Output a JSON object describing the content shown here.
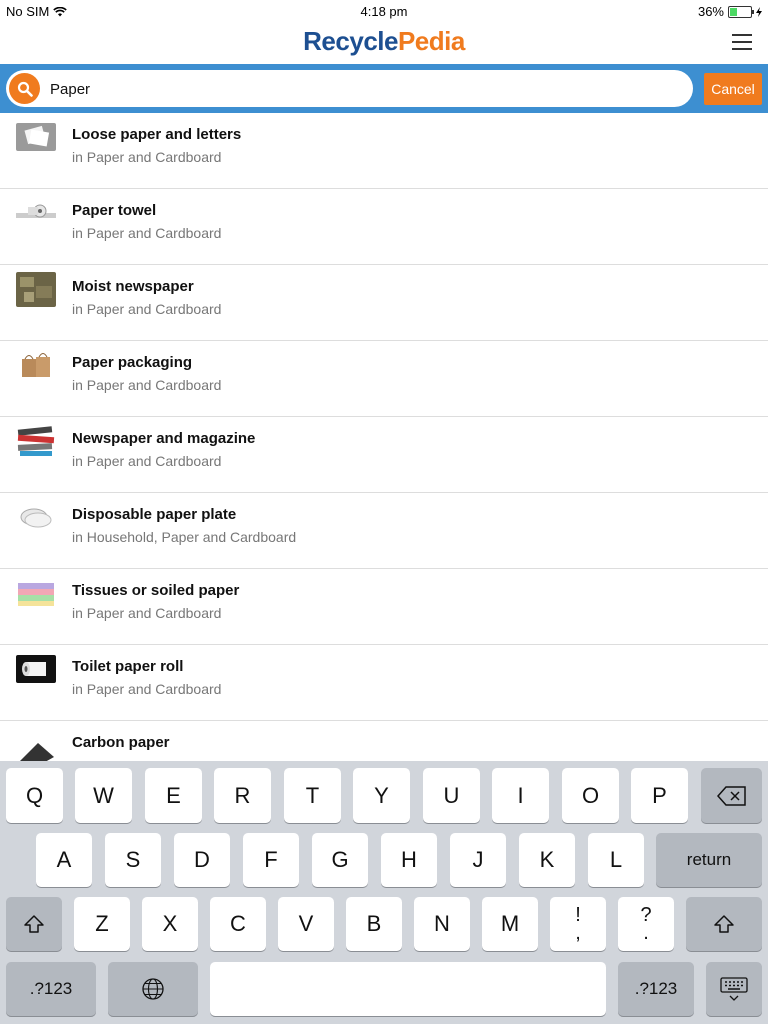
{
  "status": {
    "carrier": "No SIM",
    "time": "4:18 pm",
    "battery": "36%",
    "battery_level": 0.36
  },
  "header": {
    "logo_part1": "Recycle",
    "logo_part2": "Pedia",
    "menu_icon": "hamburger-menu-icon"
  },
  "search": {
    "value": "Paper",
    "cancel_label": "Cancel",
    "icon": "search-icon"
  },
  "results": [
    {
      "title": "Loose paper and letters",
      "category": "in Paper and Cardboard"
    },
    {
      "title": "Paper towel",
      "category": "in Paper and Cardboard"
    },
    {
      "title": "Moist newspaper",
      "category": "in Paper and Cardboard"
    },
    {
      "title": "Paper packaging",
      "category": "in Paper and Cardboard"
    },
    {
      "title": "Newspaper and magazine",
      "category": "in Paper and Cardboard"
    },
    {
      "title": "Disposable paper plate",
      "category": "in Household, Paper and Cardboard"
    },
    {
      "title": "Tissues or soiled paper",
      "category": "in Paper and Cardboard"
    },
    {
      "title": "Toilet paper roll",
      "category": "in Paper and Cardboard"
    },
    {
      "title": "Carbon paper",
      "category": ""
    }
  ],
  "keyboard": {
    "row1": [
      "Q",
      "W",
      "E",
      "R",
      "T",
      "Y",
      "U",
      "I",
      "O",
      "P"
    ],
    "row2": [
      "A",
      "S",
      "D",
      "F",
      "G",
      "H",
      "J",
      "K",
      "L"
    ],
    "row3": [
      "Z",
      "X",
      "C",
      "V",
      "B",
      "N",
      "M"
    ],
    "punct1_top": "!",
    "punct1_bottom": ",",
    "punct2_top": "?",
    "punct2_bottom": ".",
    "return_label": "return",
    "numbers_label": ".?123"
  },
  "colors": {
    "brand_blue": "#1d4f91",
    "brand_orange": "#f07b1e",
    "search_bar": "#3d8fd1"
  }
}
